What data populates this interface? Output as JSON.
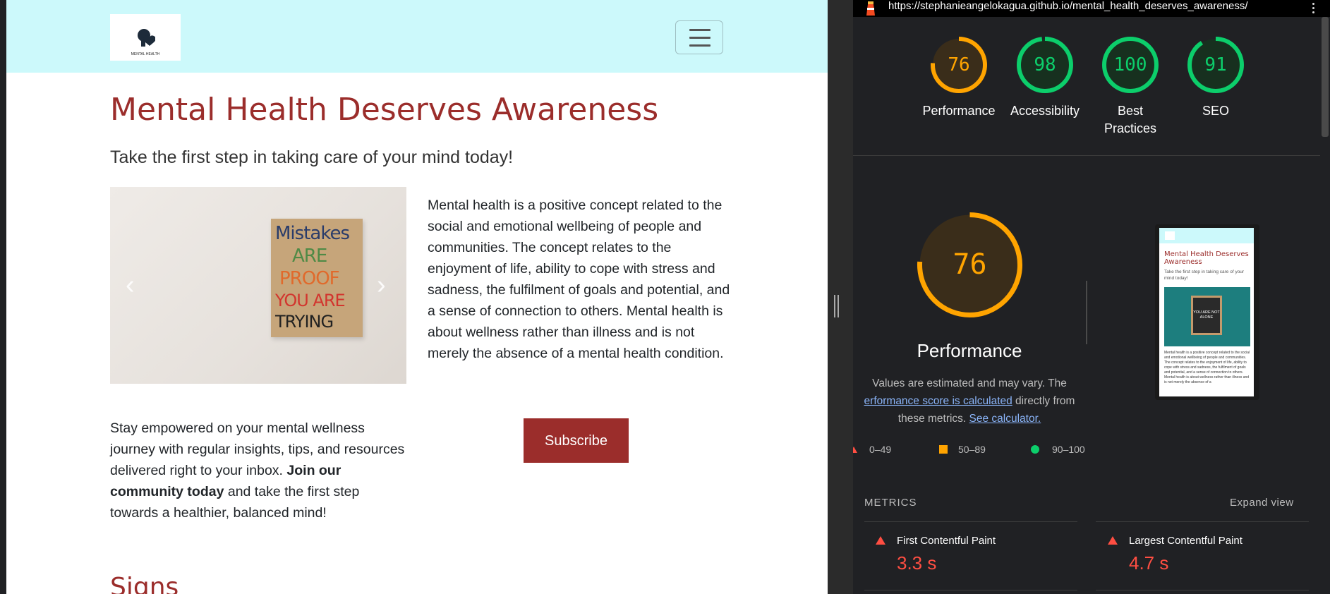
{
  "site": {
    "logo_text": "MENTAL HEALTH",
    "hero_title": "Mental Health Deserves Awareness",
    "hero_subtitle": "Take the first step in taking care of your mind today!",
    "carousel": {
      "sign_lines": [
        "Mistakes",
        "ARE",
        "PROOF",
        "YOU ARE",
        "TRYING"
      ],
      "prev": "‹",
      "next": "›"
    },
    "intro_paragraph": "Mental health is a positive concept related to the social and emotional wellbeing of people and communities. The concept relates to the enjoyment of life, ability to cope with stress and sadness, the fulfilment of goals and potential, and a sense of connection to others. Mental health is about wellness rather than illness and is not merely the absence of a mental health condition.",
    "newsletter": {
      "text_before": "Stay empowered on your mental wellness journey with regular insights, tips, and resources delivered right to your inbox. ",
      "bold": "Join our community today",
      "text_after": " and take the first step towards a healthier, balanced mind!"
    },
    "subscribe_label": "Subscribe",
    "next_section_heading": "Signs"
  },
  "lighthouse": {
    "url": "https://stephanieangelokagua.github.io/mental_health_deserves_awareness/",
    "scores": [
      {
        "label": "Performance",
        "value": 76,
        "color": "#ffa400"
      },
      {
        "label": "Accessibility",
        "value": 98,
        "color": "#0cce6b"
      },
      {
        "label": "Best Practices",
        "value": 100,
        "color": "#0cce6b"
      },
      {
        "label": "SEO",
        "value": 91,
        "color": "#0cce6b"
      }
    ],
    "performance": {
      "score": 76,
      "title": "Performance",
      "note_start": "Values are estimated and may vary. The ",
      "note_link": "erformance score is calculated",
      "note_mid": " directly from these metrics. ",
      "note_link2": "See calculator."
    },
    "legend": [
      {
        "range": "0–49",
        "color": "#ff4e42"
      },
      {
        "range": "50–89",
        "color": "#ffa400"
      },
      {
        "range": "90–100",
        "color": "#0cce6b"
      }
    ],
    "thumbnail": {
      "title": "Mental Health Deserves Awareness",
      "subtitle": "Take the first step in taking care of your mind today!",
      "board_text": "YOU ARE NOT ALONE",
      "text": "Mental health is a positive concept related to the social and emotional wellbeing of people and communities. The concept relates to the enjoyment of life, ability to cope with stress and sadness, the fulfilment of goals and potential, and a sense of connection to others. Mental health is about wellness rather than illness and is not merely the absence of a"
    },
    "metrics_title": "METRICS",
    "expand_label": "Expand view",
    "metrics": [
      {
        "name": "First Contentful Paint",
        "value": "3.3 s"
      },
      {
        "name": "Largest Contentful Paint",
        "value": "4.7 s"
      }
    ]
  }
}
